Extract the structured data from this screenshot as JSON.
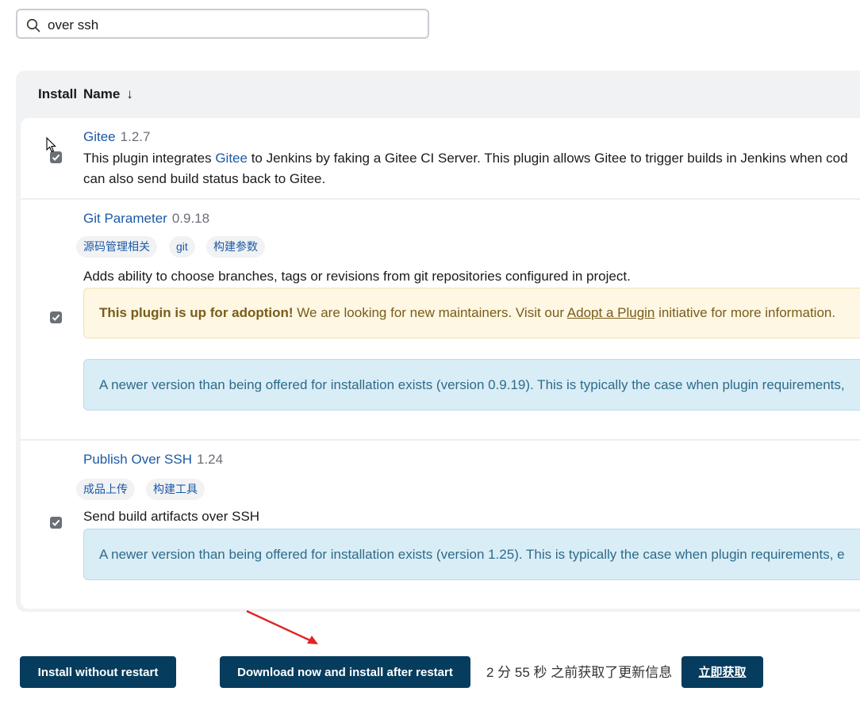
{
  "search": {
    "value": "over ssh",
    "icon": "search-icon"
  },
  "table": {
    "headers": {
      "install": "Install",
      "name": "Name",
      "sort_indicator": "↓"
    }
  },
  "plugins": [
    {
      "name": "Gitee",
      "version": "1.2.7",
      "checked": true,
      "desc_prefix": "This plugin integrates ",
      "desc_link": "Gitee",
      "desc_suffix": " to Jenkins by faking a Gitee CI Server. This plugin allows Gitee to trigger builds in Jenkins when cod",
      "desc_line2": "can also send build status back to Gitee."
    },
    {
      "name": "Git Parameter",
      "version": "0.9.18",
      "checked": true,
      "tags": [
        "源码管理相关",
        "git",
        "构建参数"
      ],
      "description": "Adds ability to choose branches, tags or revisions from git repositories configured in project.",
      "adoption_bold": "This plugin is up for adoption!",
      "adoption_text": " We are looking for new maintainers. Visit our ",
      "adoption_link": "Adopt a Plugin",
      "adoption_suffix": " initiative for more information.",
      "newer_notice": "A newer version than being offered for installation exists (version 0.9.19). This is typically the case when plugin requirements,"
    },
    {
      "name": "Publish Over SSH",
      "version": "1.24",
      "checked": true,
      "tags": [
        "成品上传",
        "构建工具"
      ],
      "description": "Send build artifacts over SSH",
      "newer_notice": "A newer version than being offered for installation exists (version 1.25). This is typically the case when plugin requirements, e"
    }
  ],
  "footer": {
    "install_without_restart": "Install without restart",
    "download_install_after_restart": "Download now and install after restart",
    "updated_text": "2 分 55 秒 之前获取了更新信息",
    "fetch_now": "立即获取"
  },
  "colors": {
    "primary_button": "#063c5e",
    "link": "#1c5aa6",
    "annotation_arrow": "#e02424"
  }
}
